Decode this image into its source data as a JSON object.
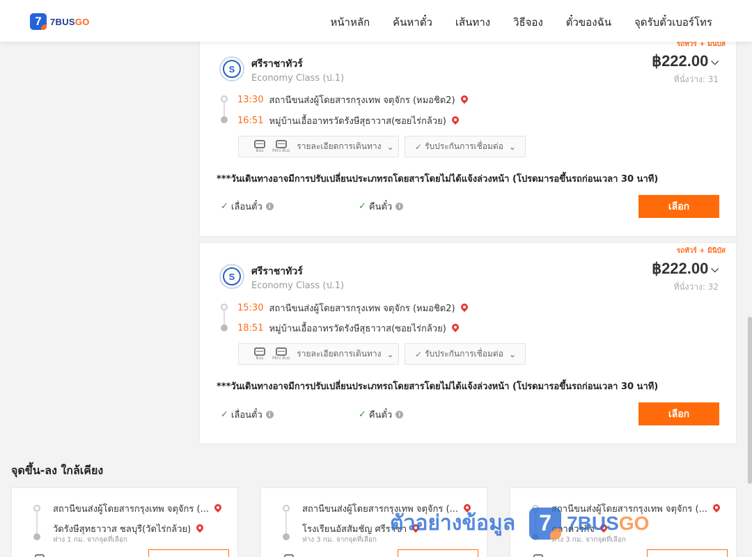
{
  "header": {
    "logo_digit": "7",
    "logo_word_a": "7BUS",
    "logo_word_b": "GO",
    "nav": [
      "หน้าหลัก",
      "ค้นหาตั๋ว",
      "เส้นทาง",
      "วิธีจอง",
      "ตั๋วของฉัน",
      "จุดรับตั๋วเบอร์โทร"
    ]
  },
  "trips": [
    {
      "tag": "รถทัวร์ + มินิบัส",
      "operator": "ศรีราชาทัวร์",
      "class": "Economy Class (ป.1)",
      "price": "฿222.00",
      "seats": "ที่นั่งว่าง: 31",
      "depart_time": "13:30",
      "depart_stop": "สถานีขนส่งผู้โดยสารกรุงเทพ จตุจักร (หมอชิต2)",
      "arrive_time": "16:51",
      "arrive_stop": "หมู่บ้านเอื้ออาทรวัดรังษีสุธาวาส(ซอยไร่กล้วย)",
      "bus_label": "Bus",
      "minibus_label": "Mini Bus",
      "details_label": "รายละเอียดการเดินทาง",
      "guarantee_label": "รับประกันการเชื่อมต่อ",
      "notice": "***วันเดินทางอาจมีการปรับเปลี่ยนประเภทรถโดยสารโดยไม่ได้แจ้งล่วงหน้า (โปรดมารอขึ้นรถก่อนเวลา 30 นาที)",
      "reschedule": "เลื่อนตั๋ว",
      "refund": "คืนตั๋ว",
      "select": "เลือก"
    },
    {
      "tag": "รถทัวร์ + มินิบัส",
      "operator": "ศรีราชาทัวร์",
      "class": "Economy Class (ป.1)",
      "price": "฿222.00",
      "seats": "ที่นั่งว่าง: 32",
      "depart_time": "15:30",
      "depart_stop": "สถานีขนส่งผู้โดยสารกรุงเทพ จตุจักร (หมอชิต2)",
      "arrive_time": "18:51",
      "arrive_stop": "หมู่บ้านเอื้ออาทรวัดรังษีสุธาวาส(ซอยไร่กล้วย)",
      "bus_label": "Bus",
      "minibus_label": "Mini Bus",
      "details_label": "รายละเอียดการเดินทาง",
      "guarantee_label": "รับประกันการเชื่อมต่อ",
      "notice": "***วันเดินทางอาจมีการปรับเปลี่ยนประเภทรถโดยสารโดยไม่ได้แจ้งล่วงหน้า (โปรดมารอขึ้นรถก่อนเวลา 30 นาที)",
      "reschedule": "เลื่อนตั๋ว",
      "refund": "คืนตั๋ว",
      "select": "เลือก"
    }
  ],
  "nearby": {
    "title": "จุดขึ้น-ลง ใกล้เคียง",
    "items": [
      {
        "from": "สถานีขนส่งผู้โดยสารกรุงเทพ จตุจักร (...",
        "to": "วัดรังษีสุทธาวาส ชลบุรี(วัดไร่กล้วย)",
        "distance": "ห่าง 1 กม. จากจุดที่เลือก"
      },
      {
        "from": "สถานีขนส่งผู้โดยสารกรุงเทพ จตุจักร (...",
        "to": "โรงเรียนอัสสัมชัญ ศรีราชา",
        "distance": "ห่าง 3 กม. จากจุดที่เลือก"
      },
      {
        "from": "สถานีขนส่งผู้โดยสารกรุงเทพ จตุจักร (...",
        "to": "ตลาดวรกิจ",
        "distance": "ห่าง 3 กม. จากจุดที่เลือก"
      }
    ]
  },
  "watermark": {
    "text": "ตัวอย่างข้อมูล",
    "digit": "7",
    "brand_a": "7BUS",
    "brand_b": "GO"
  },
  "colors": {
    "accent": "#ff6b0a",
    "brand_blue": "#2563d9",
    "check_green": "#2e9b3a",
    "pin_red": "#e53935"
  }
}
